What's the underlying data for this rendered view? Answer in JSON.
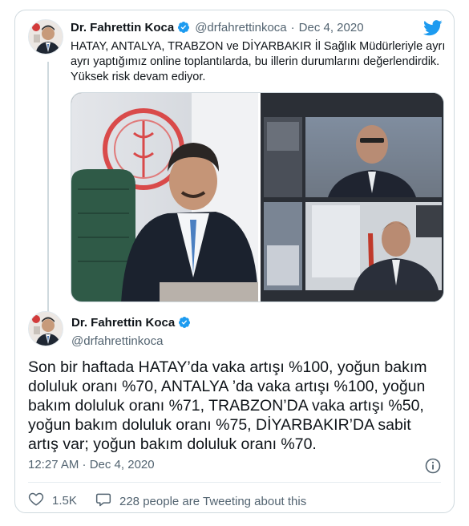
{
  "tweet1": {
    "author_name": "Dr. Fahrettin Koca",
    "handle": "@drfahrettinkoca",
    "separator": "·",
    "date": "Dec 4, 2020",
    "text": "HATAY, ANTALYA, TRABZON ve DİYARBAKIR İl Sağlık Müdürleriyle ayrı ayrı yaptığımız online toplantılarda, bu illerin durumlarını değerlendirdik. Yüksek risk devam ediyor."
  },
  "tweet2": {
    "author_name": "Dr. Fahrettin Koca",
    "handle": "@drfahrettinkoca",
    "text": "Son bir haftada HATAY’da vaka artışı %100, yoğun bakım doluluk oranı %70, ANTALYA ’da vaka artışı %100,  yoğun bakım doluluk oranı %71, TRABZON’DA vaka artışı  %50, yoğun bakım doluluk oranı %75, DİYARBAKIR’DA sabit artış var; yoğun bakım doluluk oranı %70.",
    "timestamp": "12:27 AM · Dec 4, 2020",
    "likes": "1.5K",
    "tweeting_about": "228 people are Tweeting about this"
  },
  "icons": {
    "brand": "twitter-bird-icon",
    "verified": "verified-badge-icon",
    "info": "info-icon",
    "like": "heart-icon",
    "reply": "speech-bubble-icon"
  },
  "colors": {
    "twitter_blue": "#1d9bf0",
    "text_primary": "#0f1419",
    "text_secondary": "#536471",
    "border": "#cfd9de"
  }
}
